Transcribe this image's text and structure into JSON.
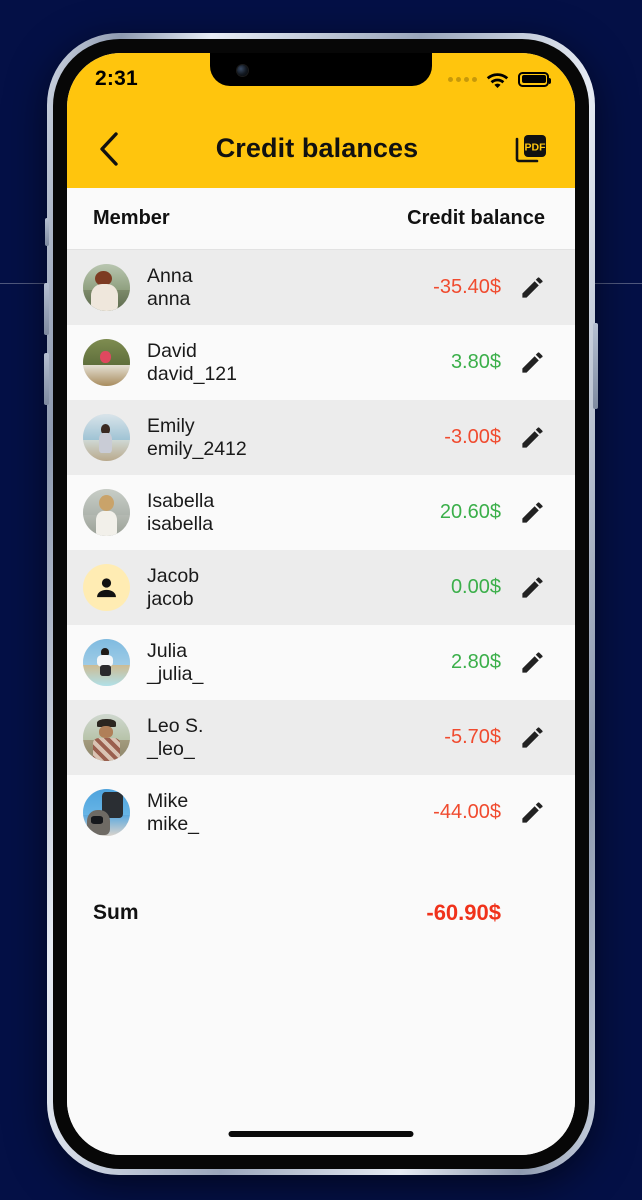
{
  "background": {
    "color": "#041046",
    "grid_line_color": "#ffffff"
  },
  "theme": {
    "accent_yellow": "#FFC50D",
    "negative_color": "#F04B2F",
    "positive_color": "#3BAF4A",
    "sum_color": "#F0321B",
    "row_alt_bg": "#ECECEC",
    "row_bg": "#FAFAFA"
  },
  "status_bar": {
    "time": "2:31",
    "signal_icon": "cellular-dots-icon",
    "wifi_icon": "wifi-icon",
    "battery_icon": "battery-full-icon"
  },
  "app_bar": {
    "back_icon": "chevron-left-icon",
    "title": "Credit balances",
    "pdf_icon": "pdf-export-icon",
    "pdf_label": "PDF"
  },
  "list_header": {
    "member": "Member",
    "balance": "Credit balance"
  },
  "members": [
    {
      "name": "Anna",
      "handle": "anna",
      "amount": "-35.40$",
      "sign": "neg",
      "avatar": "photo",
      "edit_icon": "pencil-icon"
    },
    {
      "name": "David",
      "handle": "david_121",
      "amount": "3.80$",
      "sign": "pos",
      "avatar": "photo",
      "edit_icon": "pencil-icon"
    },
    {
      "name": "Emily",
      "handle": "emily_2412",
      "amount": "-3.00$",
      "sign": "neg",
      "avatar": "photo",
      "edit_icon": "pencil-icon"
    },
    {
      "name": "Isabella",
      "handle": "isabella",
      "amount": "20.60$",
      "sign": "pos",
      "avatar": "photo",
      "edit_icon": "pencil-icon"
    },
    {
      "name": "Jacob",
      "handle": "jacob",
      "amount": "0.00$",
      "sign": "pos",
      "avatar": "placeholder",
      "edit_icon": "pencil-icon"
    },
    {
      "name": "Julia",
      "handle": "_julia_",
      "amount": "2.80$",
      "sign": "pos",
      "avatar": "photo",
      "edit_icon": "pencil-icon"
    },
    {
      "name": "Leo S.",
      "handle": "_leo_",
      "amount": "-5.70$",
      "sign": "neg",
      "avatar": "photo",
      "edit_icon": "pencil-icon"
    },
    {
      "name": "Mike",
      "handle": "mike_",
      "amount": "-44.00$",
      "sign": "neg",
      "avatar": "photo",
      "edit_icon": "pencil-icon"
    }
  ],
  "summary": {
    "label": "Sum",
    "value": "-60.90$"
  },
  "home_indicator": "home-indicator"
}
